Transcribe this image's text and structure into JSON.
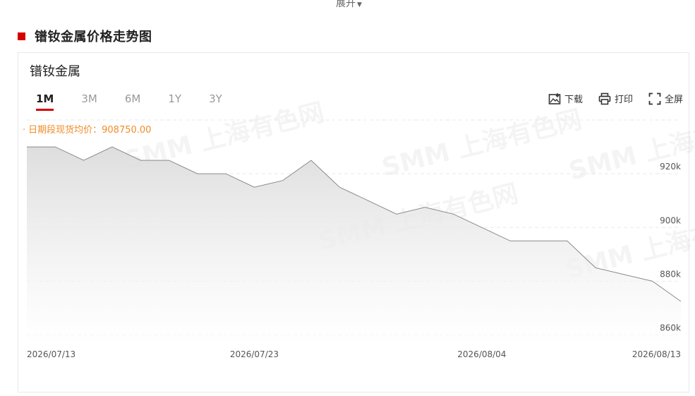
{
  "header": {
    "expand_label": "展开"
  },
  "section": {
    "title": "镨钕金属价格走势图"
  },
  "card": {
    "title": "镨钕金属",
    "tabs": [
      "1M",
      "3M",
      "6M",
      "1Y",
      "3Y"
    ],
    "active_tab": "1M",
    "tools": {
      "download": "下载",
      "print": "打印",
      "fullscreen": "全屏"
    },
    "avg_label": "日期段现货均价：908750.00"
  },
  "watermark": {
    "logo": "SMM",
    "text": "上海有色网"
  },
  "colors": {
    "accent": "#d50000",
    "avg_text": "#f08c28",
    "line": "#8a8a8a",
    "grid": "#e9e9e9"
  },
  "chart_data": {
    "type": "area",
    "title": "",
    "xlabel": "",
    "ylabel": "",
    "x": [
      "2026/07/13",
      "2026/07/14",
      "2026/07/15",
      "2026/07/16",
      "2026/07/17",
      "2026/07/20",
      "2026/07/21",
      "2026/07/22",
      "2026/07/23",
      "2026/07/24",
      "2026/07/27",
      "2026/07/28",
      "2026/07/29",
      "2026/07/30",
      "2026/07/31",
      "2026/08/03",
      "2026/08/04",
      "2026/08/05",
      "2026/08/06",
      "2026/08/07",
      "2026/08/10",
      "2026/08/11",
      "2026/08/12",
      "2026/08/13"
    ],
    "values": [
      930000,
      930000,
      925000,
      930000,
      925000,
      925000,
      920000,
      920000,
      915000,
      917500,
      925000,
      915000,
      910000,
      905000,
      907500,
      905000,
      900000,
      895000,
      895000,
      895000,
      885000,
      882500,
      880000,
      872500
    ],
    "x_tick_labels": [
      "2026/07/13",
      "2026/07/23",
      "2026/08/04",
      "2026/08/13"
    ],
    "y_tick_labels": [
      "860k",
      "880k",
      "900k",
      "920k"
    ],
    "y_ticks": [
      860000,
      880000,
      900000,
      920000
    ],
    "ylim": [
      857000,
      940000
    ],
    "grid": true,
    "legend": "none"
  }
}
